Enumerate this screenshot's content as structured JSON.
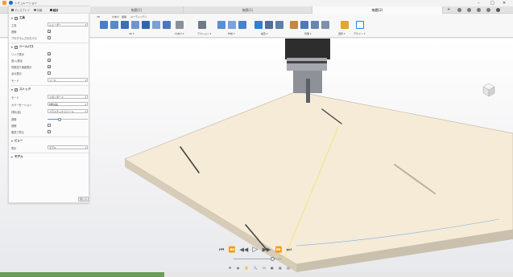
{
  "window": {
    "title": "シミュレーション"
  },
  "tabs": [
    {
      "label": "無題(1)",
      "active": false
    },
    {
      "label": "無題(1)",
      "active": false
    },
    {
      "label": "無題(2)",
      "active": true
    }
  ],
  "toolbar": {
    "groups": [
      "3D",
      "穴あけ",
      "旋盤",
      "ユーティリティ"
    ],
    "menus": [
      "3D ▾",
      "穴あけ ▾",
      "アクション ▾",
      "作成 ▾",
      "検査 ▾",
      "管理 ▾",
      "選択 ▾",
      "デザイン ▾"
    ]
  },
  "panel": {
    "tabs": [
      "ディスプレイ",
      "情報",
      "統計"
    ],
    "sections": {
      "tool": {
        "title": "工具",
        "rows": [
          {
            "label": "工具",
            "value": "シェーダー"
          },
          {
            "label": "透明",
            "checked": true
          },
          {
            "label": "プログラムされたパス",
            "checked": false
          }
        ]
      },
      "toolpath": {
        "title": "ツールパス",
        "rows": [
          {
            "label": "リンク表示",
            "checked": true
          },
          {
            "label": "進入/退出",
            "checked": true
          },
          {
            "label": "切削送り速度表示",
            "checked": true
          },
          {
            "label": "点の表示",
            "checked": false
          },
          {
            "label": "モード",
            "value": "ツール"
          }
        ]
      },
      "stock": {
        "title": "ストック",
        "rows": [
          {
            "label": "モード",
            "value": "スタンダード"
          },
          {
            "label": "カラーゼーション",
            "value": "材料(品)"
          },
          {
            "label": "材料(品)",
            "value": "プラスチック ビニール"
          },
          {
            "label": "透明",
            "slider": 0.3
          },
          {
            "label": "透明",
            "checked": false
          },
          {
            "label": "衝突で停止",
            "checked": false
          }
        ]
      },
      "view": {
        "title": "ビュー",
        "rows": [
          {
            "label": "表示",
            "value": "モデル"
          }
        ]
      },
      "model": {
        "title": "モデル"
      }
    },
    "close_label": "閉じる"
  },
  "playback": {
    "icons": [
      "skip-back-icon",
      "step-back-icon",
      "rewind-icon",
      "play-icon",
      "fast-forward-icon",
      "step-forward-icon",
      "skip-forward-icon"
    ],
    "progress": 0.32
  },
  "colors": {
    "stock_top": "#f5ebd7",
    "stock_side": "#c9c0ad",
    "tool_dark": "#2d2d2d",
    "tool_light": "#a5a8ae",
    "accent": "#2f7fd6",
    "progress": "#6b9c5a"
  }
}
